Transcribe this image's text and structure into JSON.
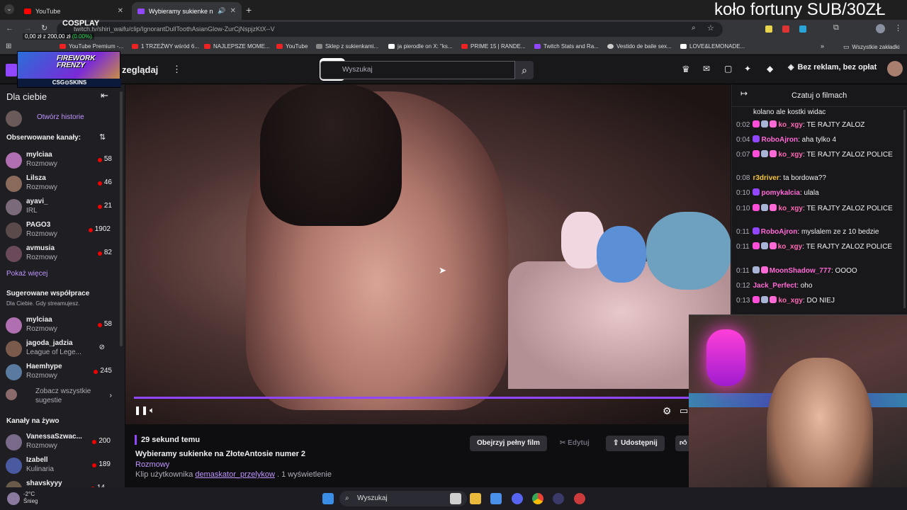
{
  "browser": {
    "tabs": [
      {
        "label": "YouTube",
        "color": "#ff0000"
      },
      {
        "label": "Wybieramy sukienke na Złoł",
        "color": "#9147ff"
      }
    ],
    "url": "twitch.tv/shiri_waifu/clip/IgnorantDullToothAsianGlow-ZurCjNspjzKtX--V",
    "bookmarks": [
      "YouTube Premium -...",
      "1 TRZEŹWY wśród 6...",
      "NAJLEPSZE MOME...",
      "YouTube",
      "Sklep z sukienkami...",
      "ja pierodle on X: \"ks...",
      "PRIME 15 | RANDE...",
      "Twitch Stats and Ra...",
      "Vestido de baile sex...",
      "LOVE&LEMONADE..."
    ],
    "all_bookmarks": "Wszystkie zakładki"
  },
  "overlay": {
    "cosplay": "COSPLAY",
    "money_prefix": "0,00 zł z 200,00 zł",
    "money_pct": "(0.00%)",
    "banner_title_1": "FIREWORK",
    "banner_title_2": "FRENZY",
    "banner_sponsor": "CSG⊙SKINS",
    "top_title": "koło fortuny SUB/30ZŁ"
  },
  "twitch_nav": {
    "browse": "zeglądaj",
    "search_placeholder": "Wyszukaj",
    "ad_free": "Bez reklam, bez opłat"
  },
  "sidebar": {
    "for_you": "Dla ciebie",
    "open_stories": "Otwórz historie",
    "followed": "Obserwowane kanały:",
    "followed_channels": [
      {
        "name": "mylciaa",
        "category": "Rozmowy",
        "viewers": "58"
      },
      {
        "name": "Lilsza",
        "category": "Rozmowy",
        "viewers": "46"
      },
      {
        "name": "ayavi_",
        "category": "IRL",
        "viewers": "21"
      },
      {
        "name": "PAGO3",
        "category": "Rozmowy",
        "viewers": "1902"
      },
      {
        "name": "avmusia",
        "category": "Rozmowy",
        "viewers": "82"
      }
    ],
    "show_more": "Pokaż więcej",
    "suggested_header": "Sugerowane współprace",
    "suggested_sub": "Dla Ciebie. Gdy streamujesz.",
    "suggested_channels": [
      {
        "name": "mylciaa",
        "category": "Rozmowy",
        "viewers": "58"
      },
      {
        "name": "jagoda_jadzia",
        "category": "League of Lege...",
        "viewers": ""
      },
      {
        "name": "Haemhype",
        "category": "Rozmowy",
        "viewers": "245"
      }
    ],
    "see_all_1": "Zobacz wszystkie",
    "see_all_2": "sugestie",
    "live_header": "Kanały na żywo",
    "live_channels": [
      {
        "name": "VanessaSzwac...",
        "category": "Rozmowy",
        "viewers": "200"
      },
      {
        "name": "Izabell",
        "category": "Kulinaria",
        "viewers": "189"
      },
      {
        "name": "shavskyyy",
        "category": "",
        "viewers": "14"
      }
    ]
  },
  "player": {
    "progress": 0.95
  },
  "clip": {
    "time_ago": "29 sekund temu",
    "title": "Wybieramy sukienke na ZłoteAntosie numer 2",
    "category": "Rozmowy",
    "by_prefix": "Klip użytkownika",
    "author": "demaskator_przelykow",
    "views": ". 1 wyświetlenie",
    "watch_full": "Obejrzyj pełny film",
    "edit": "Edytuj",
    "share": "Udostępnij"
  },
  "chat": {
    "header": "Czatuj o filmach",
    "lines": [
      {
        "time": "",
        "user": "",
        "color": "#efeff1",
        "msg": "kolano ale kostki widac"
      },
      {
        "time": "0:02",
        "user": "ko_xgy",
        "color": "#ff69b4",
        "msg": ": TE RAJTY ZALOZ"
      },
      {
        "time": "0:04",
        "user": "RoboAjron",
        "color": "#ff6ad5",
        "msg": ": aha tylko 4"
      },
      {
        "time": "0:07",
        "user": "ko_xgy",
        "color": "#ff69b4",
        "msg": ": TE RAJTY ZALOZ POLICE"
      },
      {
        "time": "0:08",
        "user": "r3driver",
        "color": "#f5c542",
        "msg": ": ta bordowa??"
      },
      {
        "time": "0:10",
        "user": "pomykalcia",
        "color": "#ff6ad5",
        "msg": ": ulala"
      },
      {
        "time": "0:10",
        "user": "ko_xgy",
        "color": "#ff69b4",
        "msg": ": TE RAJTY ZALOZ POLICE"
      },
      {
        "time": "0:11",
        "user": "RoboAjron",
        "color": "#ff6ad5",
        "msg": ": myslalem ze z 10 bedzie"
      },
      {
        "time": "0:11",
        "user": "ko_xgy",
        "color": "#ff69b4",
        "msg": ": TE RAJTY ZALOZ POLICE"
      },
      {
        "time": "0:11",
        "user": "MoonShadow_777",
        "color": "#ff6ad5",
        "msg": ": OOOO"
      },
      {
        "time": "0:12",
        "user": "Jack_Perfect",
        "color": "#ff6ad5",
        "msg": ": oho"
      },
      {
        "time": "0:13",
        "user": "ko_xgy",
        "color": "#ff69b4",
        "msg": ": DO NIEJ"
      }
    ]
  },
  "taskbar": {
    "temp": "-2°C",
    "weather": "Śnieg",
    "search": "Wyszukaj"
  }
}
